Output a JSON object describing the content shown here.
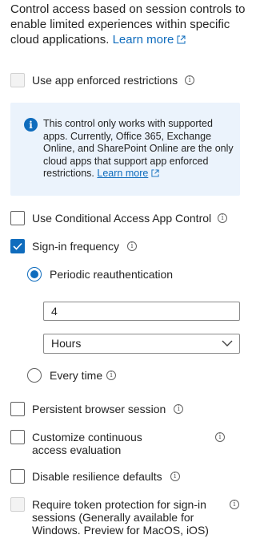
{
  "intro": {
    "text": "Control access based on session controls to enable limited experiences within specific cloud applications.",
    "learn_more": "Learn more"
  },
  "app_enforced": {
    "label": "Use app enforced restrictions",
    "checked": false,
    "disabled": true
  },
  "banner": {
    "text": "This control only works with supported apps. Currently, Office 365, Exchange Online, and SharePoint Online are the only cloud apps that support app enforced restrictions.",
    "learn_more": "Learn more"
  },
  "caac": {
    "label": "Use Conditional Access App Control",
    "checked": false
  },
  "signin_frequency": {
    "label": "Sign-in frequency",
    "checked": true,
    "periodic_label": "Periodic reauthentication",
    "value": "4",
    "unit": "Hours",
    "every_time_label": "Every time"
  },
  "persistent": {
    "label": "Persistent browser session",
    "checked": false
  },
  "continuous": {
    "label": "Customize continuous access evaluation",
    "checked": false
  },
  "resilience": {
    "label": "Disable resilience defaults",
    "checked": false
  },
  "token": {
    "label": "Require token protection for sign-in sessions (Generally available for Windows. Preview for MacOS, iOS)",
    "checked": false,
    "disabled": true
  },
  "colors": {
    "accent": "#0f6cbd",
    "banner_bg": "#ebf3fc",
    "text": "#242424"
  }
}
